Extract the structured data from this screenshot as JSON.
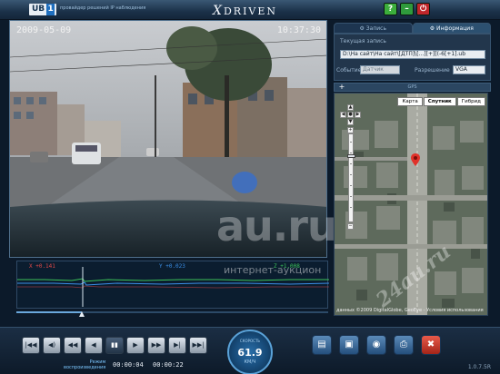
{
  "app": {
    "logo": "UB",
    "logo_num": "1",
    "tagline": "провайдер решений IP наблюдения",
    "brand_x": "X",
    "brand_rest": "DRIVEN",
    "window_buttons": [
      "?",
      "–",
      "⏻"
    ]
  },
  "video": {
    "date": "2009-05-09",
    "time": "10:37:30"
  },
  "tabs": [
    {
      "label": "Запись",
      "icon": "gear-icon"
    },
    {
      "label": "Информация",
      "icon": "gear-icon"
    }
  ],
  "info": {
    "current_label": "Текущая запись",
    "current_value": "D:\\На сайт\\На сайт\\[ДТП]\\[...][+][(-6[+1].ub",
    "event_label": "Событие",
    "event_value": "Датчик",
    "resolution_label": "Разрешение",
    "resolution_value": "VGA"
  },
  "gps": {
    "title": "GPS",
    "plus": "+",
    "map_types": [
      "Карта",
      "Спутник",
      "Гибрид"
    ],
    "selected_map_type": "Спутник",
    "copyright": "данных ©2009 DigitalGlobe, GeoEye - Условия использования"
  },
  "sensor": {
    "x_label": "X  +0.141",
    "y_label": "Y  +0.023",
    "z_label": "Z  +1.008",
    "colors": {
      "x": "#e04848",
      "y": "#3a8ee6",
      "z": "#3cc45a"
    }
  },
  "controls": {
    "buttons": [
      "|◀◀",
      "◀)",
      "◀◀",
      "◀",
      "▮▮",
      "▶",
      "▶▶",
      "▶|",
      "▶▶|"
    ],
    "slow_label_1": "Режим",
    "slow_label_2": "воспроизведения",
    "elapsed": "00:00:04",
    "duration": "00:00:22",
    "speed_caption": "СКОРОСТЬ",
    "speed_value": "61.9",
    "speed_unit": "КМ/Ч",
    "version": "1.0.7.5R"
  },
  "watermark": {
    "domain": "au.ru",
    "subtitle": "интернет-аукцион",
    "corner": "24au.ru"
  }
}
